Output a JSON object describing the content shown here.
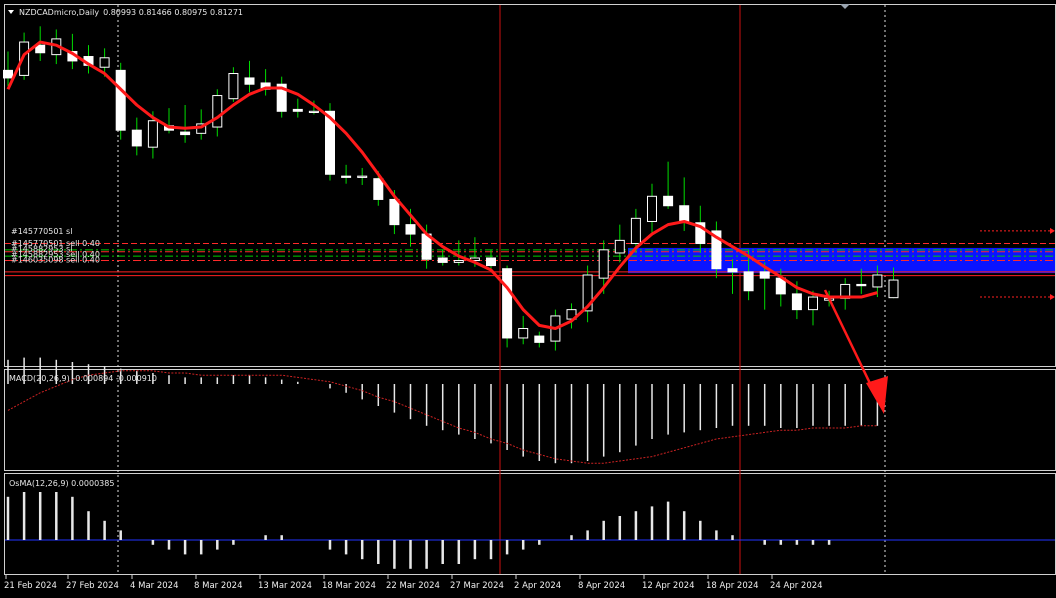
{
  "colors": {
    "background": "#000000",
    "bull_candle": "#ffffff",
    "bear_candle": "#ffffff",
    "wick": "#00dd00",
    "ma_line": "#ff1a1a",
    "macd_signal": "#cc2222",
    "osma_zero": "#2233ff",
    "zone": "#0a14ff",
    "period_sep": "#cc1111",
    "order_sl": "#ff2a2a",
    "order_entry": "#00cc00"
  },
  "header": {
    "menu_icon": "triangle-down-icon",
    "symbol": "NZDCADmicro,Daily",
    "ohlc": "0.80993 0.81466 0.80975 0.81271"
  },
  "orders": {
    "sl_label": "#145770501 sl",
    "sell_labels": [
      "#145770501 sell 0.40",
      "#145882953 sl",
      "#145882953 sell 0.40",
      "#146035098 sell 0.40"
    ]
  },
  "macd": {
    "label": "MACD(20,26,9) -0.000894 -0.000910",
    "params": [
      20,
      26,
      9
    ],
    "main": -0.000894,
    "signal": -0.00091
  },
  "osma": {
    "label": "OsMA(12,26,9) 0.0000385",
    "value": 3.85e-05
  },
  "x_axis": {
    "dates": [
      "21 Feb 2024",
      "27 Feb 2024",
      "4 Mar 2024",
      "8 Mar 2024",
      "13 Mar 2024",
      "18 Mar 2024",
      "22 Mar 2024",
      "27 Mar 2024",
      "2 Apr 2024",
      "8 Apr 2024",
      "12 Apr 2024",
      "18 Apr 2024",
      "24 Apr 2024"
    ]
  },
  "chart_data": {
    "type": "candlestick",
    "symbol": "NZDCADmicro",
    "timeframe": "Daily",
    "last_candle": {
      "open": 0.80993,
      "high": 0.81466,
      "low": 0.80975,
      "close": 0.81271
    },
    "candles": [
      {
        "o": 0.826,
        "h": 0.829,
        "l": 0.8235,
        "c": 0.8248
      },
      {
        "o": 0.8252,
        "h": 0.832,
        "l": 0.8245,
        "c": 0.8305
      },
      {
        "o": 0.83,
        "h": 0.833,
        "l": 0.8275,
        "c": 0.8288
      },
      {
        "o": 0.8285,
        "h": 0.8325,
        "l": 0.827,
        "c": 0.831
      },
      {
        "o": 0.829,
        "h": 0.8318,
        "l": 0.8262,
        "c": 0.8275
      },
      {
        "o": 0.8282,
        "h": 0.83,
        "l": 0.8255,
        "c": 0.8268
      },
      {
        "o": 0.8265,
        "h": 0.8295,
        "l": 0.825,
        "c": 0.828
      },
      {
        "o": 0.826,
        "h": 0.8272,
        "l": 0.815,
        "c": 0.8165
      },
      {
        "o": 0.8165,
        "h": 0.8185,
        "l": 0.8125,
        "c": 0.814
      },
      {
        "o": 0.8138,
        "h": 0.8195,
        "l": 0.812,
        "c": 0.818
      },
      {
        "o": 0.8172,
        "h": 0.82,
        "l": 0.816,
        "c": 0.8165
      },
      {
        "o": 0.8162,
        "h": 0.8205,
        "l": 0.8145,
        "c": 0.8158
      },
      {
        "o": 0.816,
        "h": 0.8198,
        "l": 0.815,
        "c": 0.8175
      },
      {
        "o": 0.817,
        "h": 0.823,
        "l": 0.8155,
        "c": 0.822
      },
      {
        "o": 0.8215,
        "h": 0.8265,
        "l": 0.821,
        "c": 0.8255
      },
      {
        "o": 0.8248,
        "h": 0.8275,
        "l": 0.8225,
        "c": 0.8238
      },
      {
        "o": 0.824,
        "h": 0.8262,
        "l": 0.822,
        "c": 0.823
      },
      {
        "o": 0.8238,
        "h": 0.825,
        "l": 0.8185,
        "c": 0.8195
      },
      {
        "o": 0.8198,
        "h": 0.8215,
        "l": 0.8185,
        "c": 0.8195
      },
      {
        "o": 0.8195,
        "h": 0.8212,
        "l": 0.819,
        "c": 0.8195
      },
      {
        "o": 0.8195,
        "h": 0.8208,
        "l": 0.8085,
        "c": 0.8095
      },
      {
        "o": 0.8092,
        "h": 0.811,
        "l": 0.808,
        "c": 0.809
      },
      {
        "o": 0.809,
        "h": 0.8105,
        "l": 0.8078,
        "c": 0.8092
      },
      {
        "o": 0.8088,
        "h": 0.81,
        "l": 0.8045,
        "c": 0.8055
      },
      {
        "o": 0.8055,
        "h": 0.807,
        "l": 0.8,
        "c": 0.8015
      },
      {
        "o": 0.8015,
        "h": 0.804,
        "l": 0.798,
        "c": 0.8
      },
      {
        "o": 0.8,
        "h": 0.8015,
        "l": 0.7945,
        "c": 0.796
      },
      {
        "o": 0.7962,
        "h": 0.7975,
        "l": 0.795,
        "c": 0.7955
      },
      {
        "o": 0.7955,
        "h": 0.799,
        "l": 0.795,
        "c": 0.7958
      },
      {
        "o": 0.7958,
        "h": 0.7995,
        "l": 0.7948,
        "c": 0.7962
      },
      {
        "o": 0.7962,
        "h": 0.7975,
        "l": 0.794,
        "c": 0.795
      },
      {
        "o": 0.7945,
        "h": 0.795,
        "l": 0.782,
        "c": 0.7835
      },
      {
        "o": 0.7835,
        "h": 0.787,
        "l": 0.7825,
        "c": 0.785
      },
      {
        "o": 0.7838,
        "h": 0.7845,
        "l": 0.782,
        "c": 0.7828
      },
      {
        "o": 0.783,
        "h": 0.788,
        "l": 0.7815,
        "c": 0.787
      },
      {
        "o": 0.7865,
        "h": 0.789,
        "l": 0.785,
        "c": 0.788
      },
      {
        "o": 0.7878,
        "h": 0.795,
        "l": 0.786,
        "c": 0.7935
      },
      {
        "o": 0.793,
        "h": 0.799,
        "l": 0.7905,
        "c": 0.7975
      },
      {
        "o": 0.797,
        "h": 0.8015,
        "l": 0.7955,
        "c": 0.799
      },
      {
        "o": 0.7985,
        "h": 0.804,
        "l": 0.797,
        "c": 0.8025
      },
      {
        "o": 0.802,
        "h": 0.808,
        "l": 0.8,
        "c": 0.806
      },
      {
        "o": 0.806,
        "h": 0.8115,
        "l": 0.804,
        "c": 0.8045
      },
      {
        "o": 0.8045,
        "h": 0.809,
        "l": 0.8005,
        "c": 0.802
      },
      {
        "o": 0.8018,
        "h": 0.8045,
        "l": 0.797,
        "c": 0.7985
      },
      {
        "o": 0.8005,
        "h": 0.802,
        "l": 0.793,
        "c": 0.7945
      },
      {
        "o": 0.7945,
        "h": 0.796,
        "l": 0.7905,
        "c": 0.794
      },
      {
        "o": 0.794,
        "h": 0.7975,
        "l": 0.7895,
        "c": 0.791
      },
      {
        "o": 0.794,
        "h": 0.7955,
        "l": 0.788,
        "c": 0.793
      },
      {
        "o": 0.793,
        "h": 0.7945,
        "l": 0.7885,
        "c": 0.7905
      },
      {
        "o": 0.7905,
        "h": 0.7925,
        "l": 0.7865,
        "c": 0.788
      },
      {
        "o": 0.788,
        "h": 0.791,
        "l": 0.7855,
        "c": 0.79
      },
      {
        "o": 0.7895,
        "h": 0.791,
        "l": 0.7885,
        "c": 0.7898
      },
      {
        "o": 0.7898,
        "h": 0.793,
        "l": 0.788,
        "c": 0.792
      },
      {
        "o": 0.792,
        "h": 0.7945,
        "l": 0.7905,
        "c": 0.7918
      },
      {
        "o": 0.7916,
        "h": 0.795,
        "l": 0.79,
        "c": 0.7935
      },
      {
        "o": 0.7899,
        "h": 0.7947,
        "l": 0.7898,
        "c": 0.7927
      }
    ],
    "ma_line": [
      0.823,
      0.8285,
      0.8305,
      0.83,
      0.8287,
      0.827,
      0.8255,
      0.823,
      0.8205,
      0.8185,
      0.817,
      0.8168,
      0.817,
      0.8185,
      0.8205,
      0.8222,
      0.8232,
      0.8232,
      0.8222,
      0.8205,
      0.8185,
      0.816,
      0.813,
      0.8095,
      0.806,
      0.803,
      0.8,
      0.798,
      0.7965,
      0.7955,
      0.7943,
      0.7915,
      0.788,
      0.7855,
      0.785,
      0.7862,
      0.7885,
      0.7915,
      0.7948,
      0.7978,
      0.8,
      0.8015,
      0.802,
      0.8012,
      0.7995,
      0.798,
      0.7965,
      0.7948,
      0.7932,
      0.7915,
      0.7905,
      0.79,
      0.79,
      0.79,
      0.7907
    ],
    "price_levels": {
      "sl_dashed": 0.7985,
      "sell_entries": [
        0.7975,
        0.7972,
        0.7965,
        0.7958
      ],
      "support_lines": [
        0.794,
        0.7934
      ],
      "zone_top": 0.7978,
      "zone_bottom": 0.7938,
      "target_dotted_top": 0.8005,
      "target_dotted_bottom": 0.79
    },
    "y_range": [
      0.78,
      0.834
    ],
    "macd_histogram": [
      0.0011,
      0.0012,
      0.0012,
      0.0011,
      0.001,
      0.0009,
      0.0008,
      0.0007,
      0.0006,
      0.0005,
      0.0004,
      0.0003,
      0.0003,
      0.0003,
      0.0004,
      0.0004,
      0.0003,
      0.0002,
      0.0001,
      0.0,
      -0.0002,
      -0.0004,
      -0.0007,
      -0.001,
      -0.0013,
      -0.0016,
      -0.0019,
      -0.0021,
      -0.0023,
      -0.0025,
      -0.0027,
      -0.003,
      -0.0033,
      -0.0035,
      -0.0036,
      -0.0036,
      -0.0035,
      -0.0033,
      -0.0031,
      -0.0028,
      -0.0025,
      -0.0023,
      -0.0022,
      -0.0021,
      -0.002,
      -0.0019,
      -0.0019,
      -0.0019,
      -0.002,
      -0.002,
      -0.0019,
      -0.0019,
      -0.0019,
      -0.0019,
      -0.0019
    ],
    "macd_signal_line": [
      -0.0012,
      -0.0008,
      -0.0004,
      -0.0001,
      0.0002,
      0.0004,
      0.0005,
      0.0006,
      0.0006,
      0.0006,
      0.0005,
      0.0005,
      0.0004,
      0.0004,
      0.0004,
      0.0004,
      0.0004,
      0.0004,
      0.0003,
      0.0002,
      0.0001,
      -0.0001,
      -0.0003,
      -0.0006,
      -0.0008,
      -0.0011,
      -0.0014,
      -0.0017,
      -0.002,
      -0.0022,
      -0.0025,
      -0.0027,
      -0.003,
      -0.0032,
      -0.0034,
      -0.0035,
      -0.0036,
      -0.0036,
      -0.0035,
      -0.0034,
      -0.0033,
      -0.0031,
      -0.0029,
      -0.0027,
      -0.0025,
      -0.0024,
      -0.0023,
      -0.0022,
      -0.0021,
      -0.0021,
      -0.002,
      -0.002,
      -0.002,
      -0.0019,
      -0.0019
    ],
    "osma_histogram": [
      0.0009,
      0.001,
      0.001,
      0.001,
      0.0009,
      0.0006,
      0.0004,
      0.0002,
      0.0,
      -0.0001,
      -0.0002,
      -0.0003,
      -0.0003,
      -0.0002,
      -0.0001,
      0.0,
      0.0001,
      0.0001,
      0.0,
      0.0,
      -0.0002,
      -0.0003,
      -0.0004,
      -0.0005,
      -0.0006,
      -0.0006,
      -0.0006,
      -0.0005,
      -0.0005,
      -0.0004,
      -0.0004,
      -0.0003,
      -0.0002,
      -0.0001,
      0.0,
      0.0001,
      0.0002,
      0.0004,
      0.0005,
      0.0006,
      0.0007,
      0.0008,
      0.0006,
      0.0004,
      0.0002,
      0.0001,
      0.0,
      -0.0001,
      -0.0001,
      -0.0001,
      -0.0001,
      -0.0001,
      0.0,
      0.0,
      0.0
    ]
  }
}
